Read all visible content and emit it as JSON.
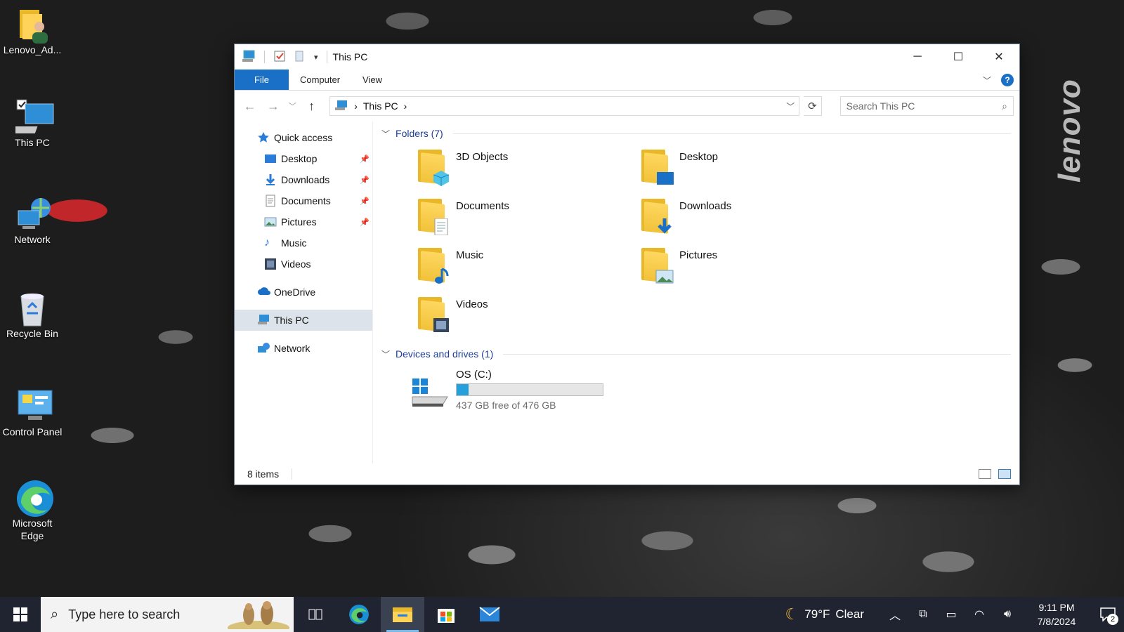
{
  "desktop": {
    "icons": [
      {
        "label": "Lenovo_Ad...",
        "icon": "user-folder-icon"
      },
      {
        "label": "This PC",
        "icon": "computer-icon"
      },
      {
        "label": "Network",
        "icon": "network-icon"
      },
      {
        "label": "Recycle Bin",
        "icon": "recycle-bin-icon"
      },
      {
        "label": "Control Panel",
        "icon": "control-panel-icon"
      },
      {
        "label": "Microsoft Edge",
        "icon": "edge-icon"
      }
    ],
    "brand": "lenovo"
  },
  "window": {
    "title": "This PC",
    "controls": {
      "minimize": "─",
      "maximize": "☐",
      "close": "✕"
    },
    "ribbon_tabs": [
      "File",
      "Computer",
      "View"
    ],
    "help": "?",
    "address": {
      "segments": [
        "This PC"
      ],
      "separator": "›"
    },
    "search": {
      "placeholder": "Search This PC"
    },
    "nav_pane": {
      "quick_access": "Quick access",
      "pinned": [
        {
          "label": "Desktop",
          "pinned": true
        },
        {
          "label": "Downloads",
          "pinned": true
        },
        {
          "label": "Documents",
          "pinned": true
        },
        {
          "label": "Pictures",
          "pinned": true
        },
        {
          "label": "Music",
          "pinned": false
        },
        {
          "label": "Videos",
          "pinned": false
        }
      ],
      "onedrive": "OneDrive",
      "this_pc": "This PC",
      "network": "Network"
    },
    "folders_header": "Folders (7)",
    "folders": [
      {
        "name": "3D Objects",
        "icon": "3d-objects-icon"
      },
      {
        "name": "Desktop",
        "icon": "desktop-folder-icon"
      },
      {
        "name": "Documents",
        "icon": "documents-folder-icon"
      },
      {
        "name": "Downloads",
        "icon": "downloads-folder-icon"
      },
      {
        "name": "Music",
        "icon": "music-folder-icon"
      },
      {
        "name": "Pictures",
        "icon": "pictures-folder-icon"
      },
      {
        "name": "Videos",
        "icon": "videos-folder-icon"
      }
    ],
    "drives_header": "Devices and drives (1)",
    "drives": [
      {
        "name": "OS (C:)",
        "free_text": "437 GB free of 476 GB",
        "used_fraction": 0.08
      }
    ],
    "status": "8 items",
    "colors": {
      "accent": "#1a6fc7",
      "drive_fill": "#26a0da",
      "group_header": "#1e3e99"
    }
  },
  "taskbar": {
    "search_placeholder": "Type here to search",
    "apps": [
      "task-view-icon",
      "edge-icon",
      "file-explorer-icon",
      "store-icon",
      "mail-icon"
    ],
    "weather": {
      "temp": "79°F",
      "condition": "Clear"
    },
    "time": "9:11 PM",
    "date": "7/8/2024",
    "notifications": "2"
  }
}
